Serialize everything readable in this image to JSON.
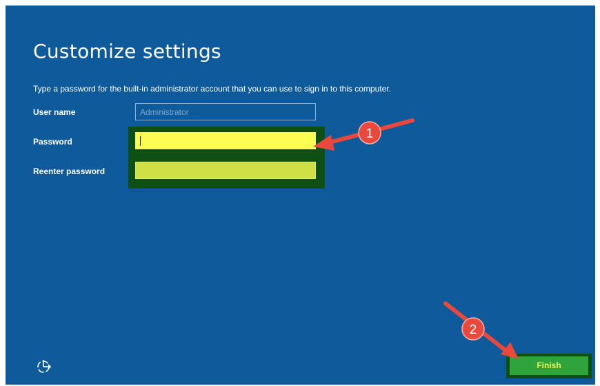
{
  "page": {
    "title": "Customize settings",
    "description": "Type a password for the built-in administrator account that you can use to sign in to this computer."
  },
  "fields": {
    "username": {
      "label": "User name",
      "placeholder": "Administrator"
    },
    "password": {
      "label": "Password",
      "value": ""
    },
    "reenter": {
      "label": "Reenter password",
      "value": ""
    }
  },
  "actions": {
    "finish_label": "Finish"
  },
  "annotations": {
    "step1": "1",
    "step2": "2"
  },
  "icons": {
    "ease_of_access": "ease-of-access-icon"
  },
  "colors": {
    "background": "#0e5a9a",
    "highlight_frame": "#0e4f13",
    "password_fill": "#fcfc52",
    "reenter_fill": "#cfe046",
    "finish_button": "#2ea43a",
    "annotation_red": "#e8493c"
  }
}
